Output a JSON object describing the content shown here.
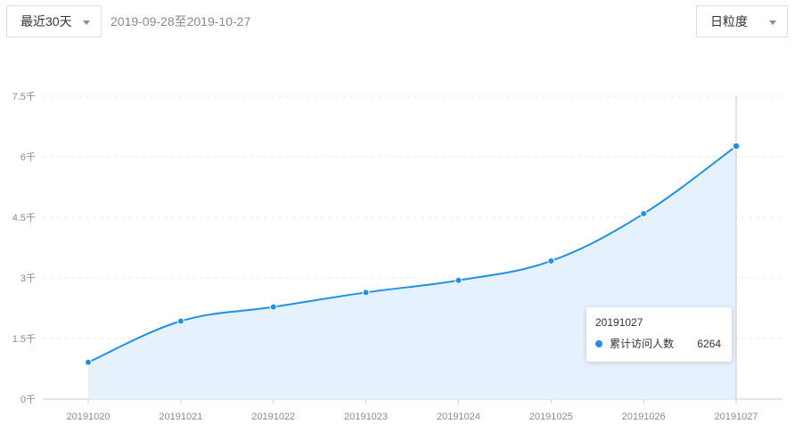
{
  "range_select": {
    "label": "最近30天"
  },
  "date_range": "2019-09-28至2019-10-27",
  "granularity_select": {
    "label": "日粒度"
  },
  "colors": {
    "line": "#1e90e8",
    "area": "#e5f1fc",
    "grid": "#e8e8e8",
    "axis_text": "#8c8c8c"
  },
  "chart_data": {
    "type": "area",
    "x": [
      "20191020",
      "20191021",
      "20191022",
      "20191023",
      "20191024",
      "20191025",
      "20191026",
      "20191027"
    ],
    "series": [
      {
        "name": "累计访问人数",
        "values": [
          910,
          1930,
          2280,
          2640,
          2940,
          3420,
          4590,
          6264
        ]
      }
    ],
    "y_ticks": [
      {
        "value": 0,
        "label": "0千"
      },
      {
        "value": 1500,
        "label": "1.5千"
      },
      {
        "value": 3000,
        "label": "3千"
      },
      {
        "value": 4500,
        "label": "4.5千"
      },
      {
        "value": 6000,
        "label": "6千"
      },
      {
        "value": 7500,
        "label": "7.5千"
      }
    ],
    "ylim": [
      0,
      7500
    ],
    "grid": true
  },
  "tooltip": {
    "title": "20191027",
    "series_name": "累计访问人数",
    "value": "6264"
  }
}
